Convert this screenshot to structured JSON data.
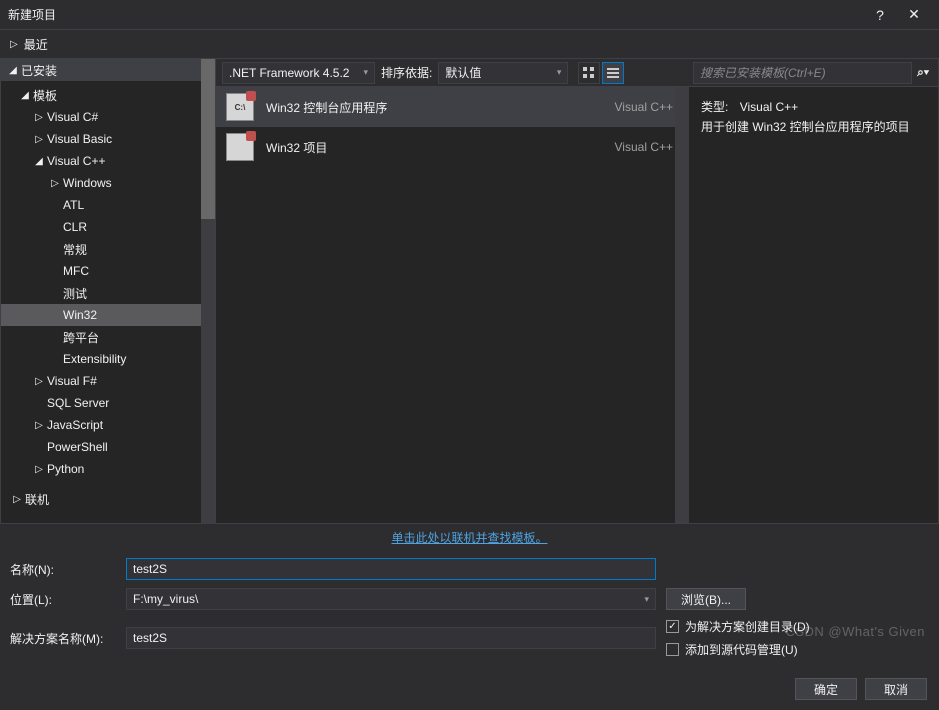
{
  "title": "新建项目",
  "titlebar": {
    "help": "?",
    "close": "✕"
  },
  "recent": {
    "label": "最近",
    "caret": "▷"
  },
  "installed": {
    "label": "已安装",
    "caret": "◢"
  },
  "tree": {
    "templates": {
      "label": "模板",
      "caret": "◢"
    },
    "csharp": {
      "label": "Visual C#",
      "caret": "▷"
    },
    "vb": {
      "label": "Visual Basic",
      "caret": "▷"
    },
    "vcpp": {
      "label": "Visual C++",
      "caret": "◢"
    },
    "windows": {
      "label": "Windows",
      "caret": "▷"
    },
    "atl": {
      "label": "ATL"
    },
    "clr": {
      "label": "CLR"
    },
    "general": {
      "label": "常规"
    },
    "mfc": {
      "label": "MFC"
    },
    "test": {
      "label": "测试"
    },
    "win32": {
      "label": "Win32"
    },
    "cross": {
      "label": "跨平台"
    },
    "ext": {
      "label": "Extensibility"
    },
    "fsharp": {
      "label": "Visual F#",
      "caret": "▷"
    },
    "sql": {
      "label": "SQL Server"
    },
    "js": {
      "label": "JavaScript",
      "caret": "▷"
    },
    "ps": {
      "label": "PowerShell"
    },
    "python": {
      "label": "Python",
      "caret": "▷"
    }
  },
  "online": {
    "label": "联机",
    "caret": "▷"
  },
  "toolbar": {
    "framework": ".NET Framework 4.5.2",
    "sort_label": "排序依据:",
    "sort_value": "默认值"
  },
  "templates": {
    "item0": {
      "name": "Win32 控制台应用程序",
      "lang": "Visual C++",
      "icontext": "C:\\"
    },
    "item1": {
      "name": "Win32 项目",
      "lang": "Visual C++",
      "icontext": ""
    }
  },
  "search": {
    "placeholder": "搜索已安装模板(Ctrl+E)"
  },
  "detail": {
    "type_label": "类型:",
    "type_value": "Visual C++",
    "desc": "用于创建 Win32 控制台应用程序的项目"
  },
  "link": "单击此处以联机并查找模板。",
  "form": {
    "name_label": "名称(N):",
    "name_value": "test2S",
    "loc_label": "位置(L):",
    "loc_value": "F:\\my_virus\\",
    "sol_label": "解决方案名称(M):",
    "sol_value": "test2S",
    "browse": "浏览(B)...",
    "check1": "为解决方案创建目录(D)",
    "check2": "添加到源代码管理(U)"
  },
  "footer": {
    "ok": "确定",
    "cancel": "取消"
  },
  "watermark": "CSDN @What's Given"
}
